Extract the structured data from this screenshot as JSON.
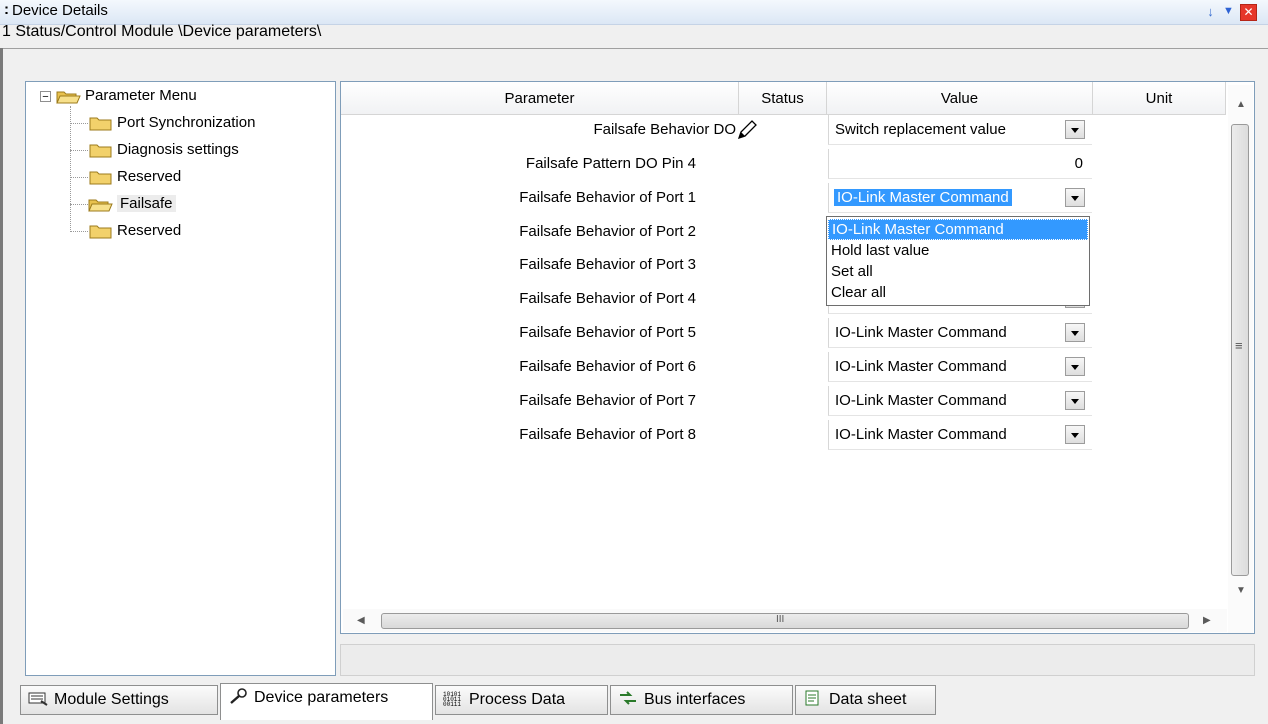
{
  "window": {
    "title": "Device Details",
    "grip": ":",
    "path": "1 Status/Control Module \\Device parameters\\",
    "buttons": {
      "pin": "↓",
      "menu": "▼",
      "close": "✕"
    }
  },
  "tree": {
    "expander": "−",
    "root": "Parameter Menu",
    "items": [
      "Port Synchronization",
      "Diagnosis settings",
      "Reserved",
      "Failsafe",
      "Reserved"
    ],
    "selected": "Failsafe"
  },
  "grid": {
    "columns": [
      "Parameter",
      "Status",
      "Value",
      "Unit"
    ],
    "rows": [
      {
        "name": "Failsafe Behavior DO",
        "value": "Switch replacement value",
        "type": "combo",
        "status": "pencil-icon"
      },
      {
        "name": "Failsafe Pattern DO Pin 4",
        "value": "0",
        "type": "number"
      },
      {
        "name": "Failsafe Behavior of Port 1",
        "value": "IO-Link Master Command",
        "type": "combo",
        "state": "open"
      },
      {
        "name": "Failsafe Behavior of Port 2",
        "value": "",
        "type": "hidden"
      },
      {
        "name": "Failsafe Behavior of Port 3",
        "value": "",
        "type": "hidden"
      },
      {
        "name": "Failsafe Behavior of Port 4",
        "value": "",
        "type": "hidden"
      },
      {
        "name": "Failsafe Behavior of Port 5",
        "value": "IO-Link Master Command",
        "type": "combo"
      },
      {
        "name": "Failsafe Behavior of Port 6",
        "value": "IO-Link Master Command",
        "type": "combo"
      },
      {
        "name": "Failsafe Behavior of Port 7",
        "value": "IO-Link Master Command",
        "type": "combo"
      },
      {
        "name": "Failsafe Behavior of Port 8",
        "value": "IO-Link Master Command",
        "type": "combo"
      }
    ]
  },
  "dropdown": {
    "options": [
      "IO-Link Master Command",
      "Hold last value",
      "Set all",
      "Clear all"
    ],
    "selected": "IO-Link Master Command"
  },
  "scrollbars": {
    "grip": "≡",
    "hgrip": "III"
  },
  "tabs": [
    {
      "label": "Module Settings",
      "icon": "module-settings-icon"
    },
    {
      "label": "Device parameters",
      "icon": "wrench-icon",
      "active": true
    },
    {
      "label": "Process Data",
      "icon": "binary-data-icon"
    },
    {
      "label": "Bus interfaces",
      "icon": "bus-interfaces-icon"
    },
    {
      "label": "Data sheet",
      "icon": "data-sheet-icon"
    }
  ],
  "colors": {
    "selection": "#3399ff",
    "close_button": "#e6372a",
    "folder": "#f2d16b"
  }
}
